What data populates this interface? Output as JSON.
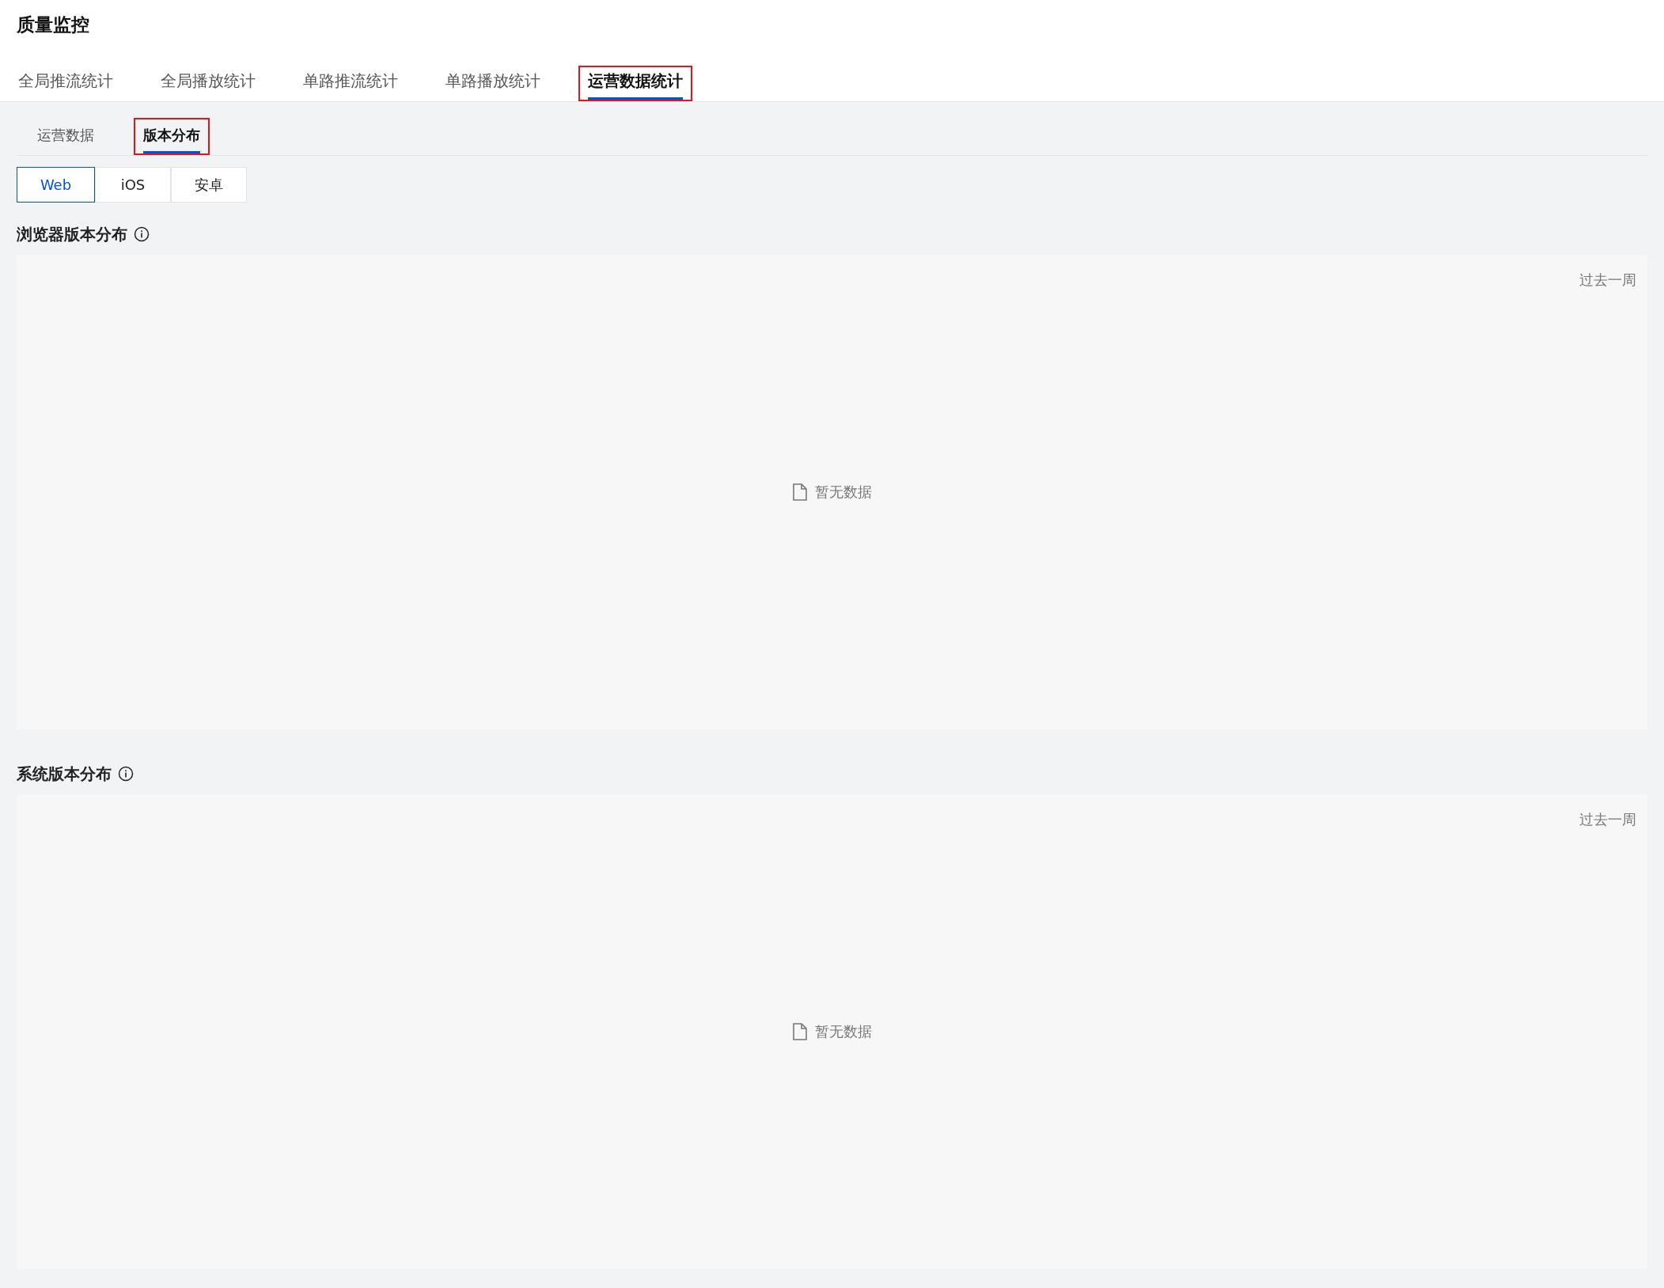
{
  "page": {
    "title": "质量监控"
  },
  "tabs": [
    {
      "label": "全局推流统计",
      "selected": false,
      "highlighted": false
    },
    {
      "label": "全局播放统计",
      "selected": false,
      "highlighted": false
    },
    {
      "label": "单路推流统计",
      "selected": false,
      "highlighted": false
    },
    {
      "label": "单路播放统计",
      "selected": false,
      "highlighted": false
    },
    {
      "label": "运营数据统计",
      "selected": true,
      "highlighted": true
    }
  ],
  "sub_tabs": [
    {
      "label": "运营数据",
      "selected": false,
      "highlighted": false
    },
    {
      "label": "版本分布",
      "selected": true,
      "highlighted": true
    }
  ],
  "platforms": [
    {
      "label": "Web",
      "selected": true
    },
    {
      "label": "iOS",
      "selected": false
    },
    {
      "label": "安卓",
      "selected": false
    }
  ],
  "sections": [
    {
      "title": "浏览器版本分布",
      "range": "过去一周",
      "empty_text": "暂无数据"
    },
    {
      "title": "系统版本分布",
      "range": "过去一周",
      "empty_text": "暂无数据"
    }
  ]
}
